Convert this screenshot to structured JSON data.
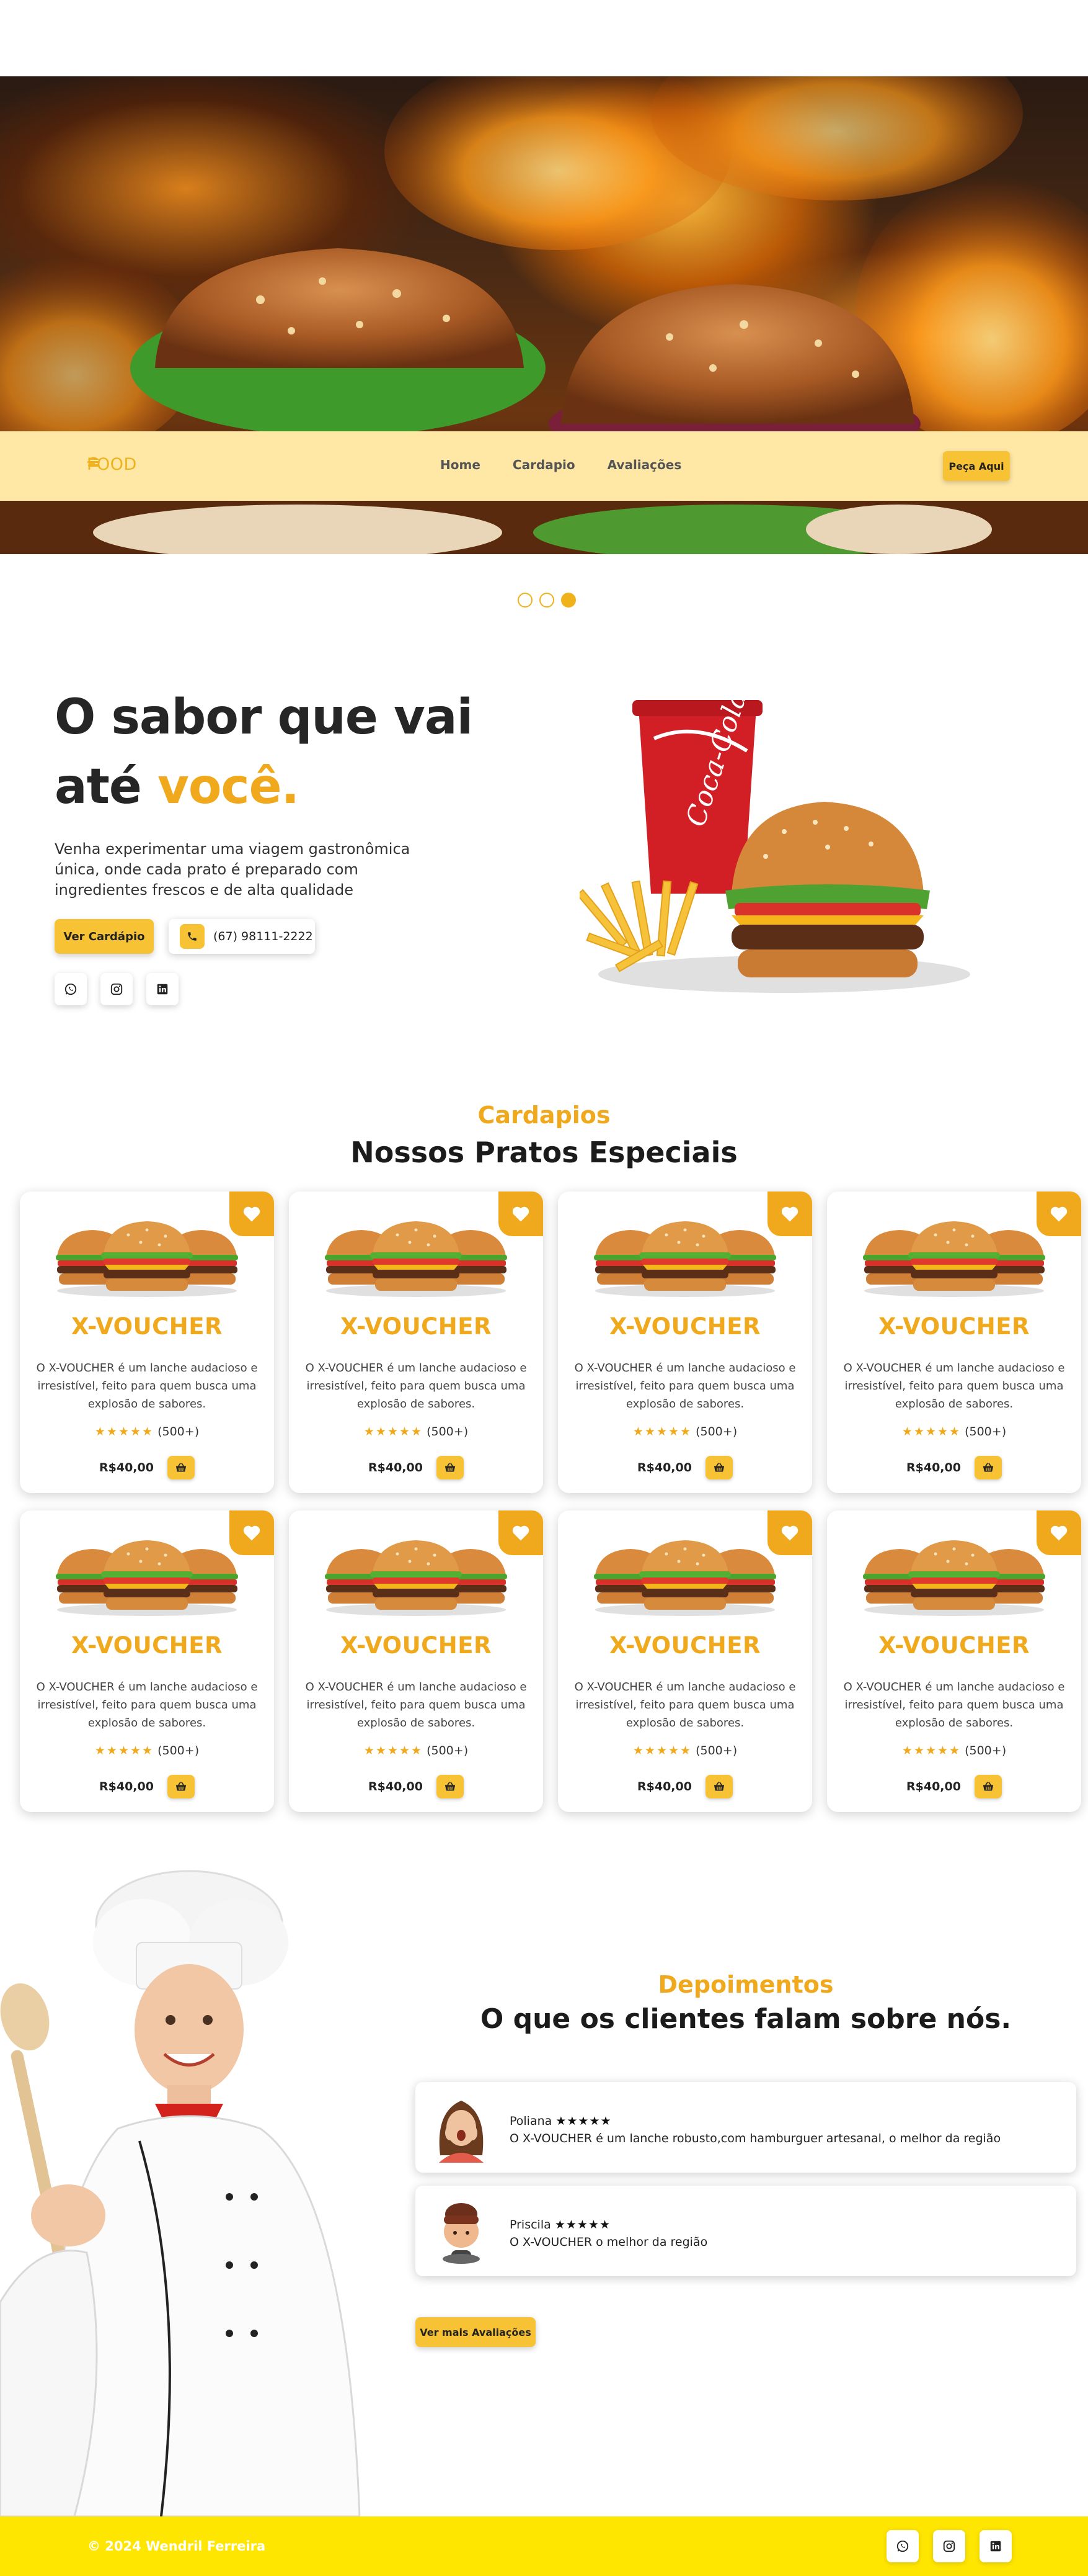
{
  "brand": {
    "logo_text": "FOOD",
    "accent": "#f0a91c",
    "button_yellow": "#f7c233",
    "nav_bg": "#ffe7a6",
    "footer_bg": "#ffe600"
  },
  "nav": {
    "links": [
      "Home",
      "Cardapio",
      "Avaliações"
    ],
    "order_button": "Peça Aqui"
  },
  "carousel": {
    "slide_count": 3,
    "active_index": 3
  },
  "intro": {
    "title_line1": "O sabor que vai",
    "title_line2_plain": "até ",
    "title_line2_accent": "você.",
    "description": "Venha experimentar uma viagem gastronômica única, onde cada prato é preparado com ingredientes frescos e de alta qualidade",
    "menu_button": "Ver Cardápio",
    "phone": "(67) 98111-2222",
    "socials": [
      "whatsapp-icon",
      "instagram-icon",
      "linkedin-icon"
    ]
  },
  "menu": {
    "subtitle": "Cardapios",
    "title": "Nossos Pratos Especiais",
    "items": [
      {
        "name": "X-VOUCHER",
        "description": "O X-VOUCHER é um lanche audacioso e irresistível, feito para quem busca uma explosão de sabores.",
        "rating": "(500+)",
        "price": "R$40,00"
      },
      {
        "name": "X-VOUCHER",
        "description": "O X-VOUCHER é um lanche audacioso e irresistível, feito para quem busca uma explosão de sabores.",
        "rating": "(500+)",
        "price": "R$40,00"
      },
      {
        "name": "X-VOUCHER",
        "description": "O X-VOUCHER é um lanche audacioso e irresistível, feito para quem busca uma explosão de sabores.",
        "rating": "(500+)",
        "price": "R$40,00"
      },
      {
        "name": "X-VOUCHER",
        "description": "O X-VOUCHER é um lanche audacioso e irresistível, feito para quem busca uma explosão de sabores.",
        "rating": "(500+)",
        "price": "R$40,00"
      },
      {
        "name": "X-VOUCHER",
        "description": "O X-VOUCHER é um lanche audacioso e irresistível, feito para quem busca uma explosão de sabores.",
        "rating": "(500+)",
        "price": "R$40,00"
      },
      {
        "name": "X-VOUCHER",
        "description": "O X-VOUCHER é um lanche audacioso e irresistível, feito para quem busca uma explosão de sabores.",
        "rating": "(500+)",
        "price": "R$40,00"
      },
      {
        "name": "X-VOUCHER",
        "description": "O X-VOUCHER é um lanche audacioso e irresistível, feito para quem busca uma explosão de sabores.",
        "rating": "(500+)",
        "price": "R$40,00"
      },
      {
        "name": "X-VOUCHER",
        "description": "O X-VOUCHER é um lanche audacioso e irresistível, feito para quem busca uma explosão de sabores.",
        "rating": "(500+)",
        "price": "R$40,00"
      }
    ]
  },
  "testimonials": {
    "subtitle": "Depoimentos",
    "title": "O que os clientes falam sobre nós.",
    "reviews": [
      {
        "name": "Poliana",
        "stars": "★★★★★",
        "text": "O X-VOUCHER é um lanche robusto,com hamburguer artesanal, o melhor da região"
      },
      {
        "name": "Priscila",
        "stars": "★★★★★",
        "text": "O X-VOUCHER o melhor da região"
      }
    ],
    "more_button": "Ver mais Avaliações"
  },
  "footer": {
    "copyright": "© 2024 Wendril Ferreira",
    "socials": [
      "whatsapp-icon",
      "instagram-icon",
      "linkedin-icon"
    ]
  }
}
